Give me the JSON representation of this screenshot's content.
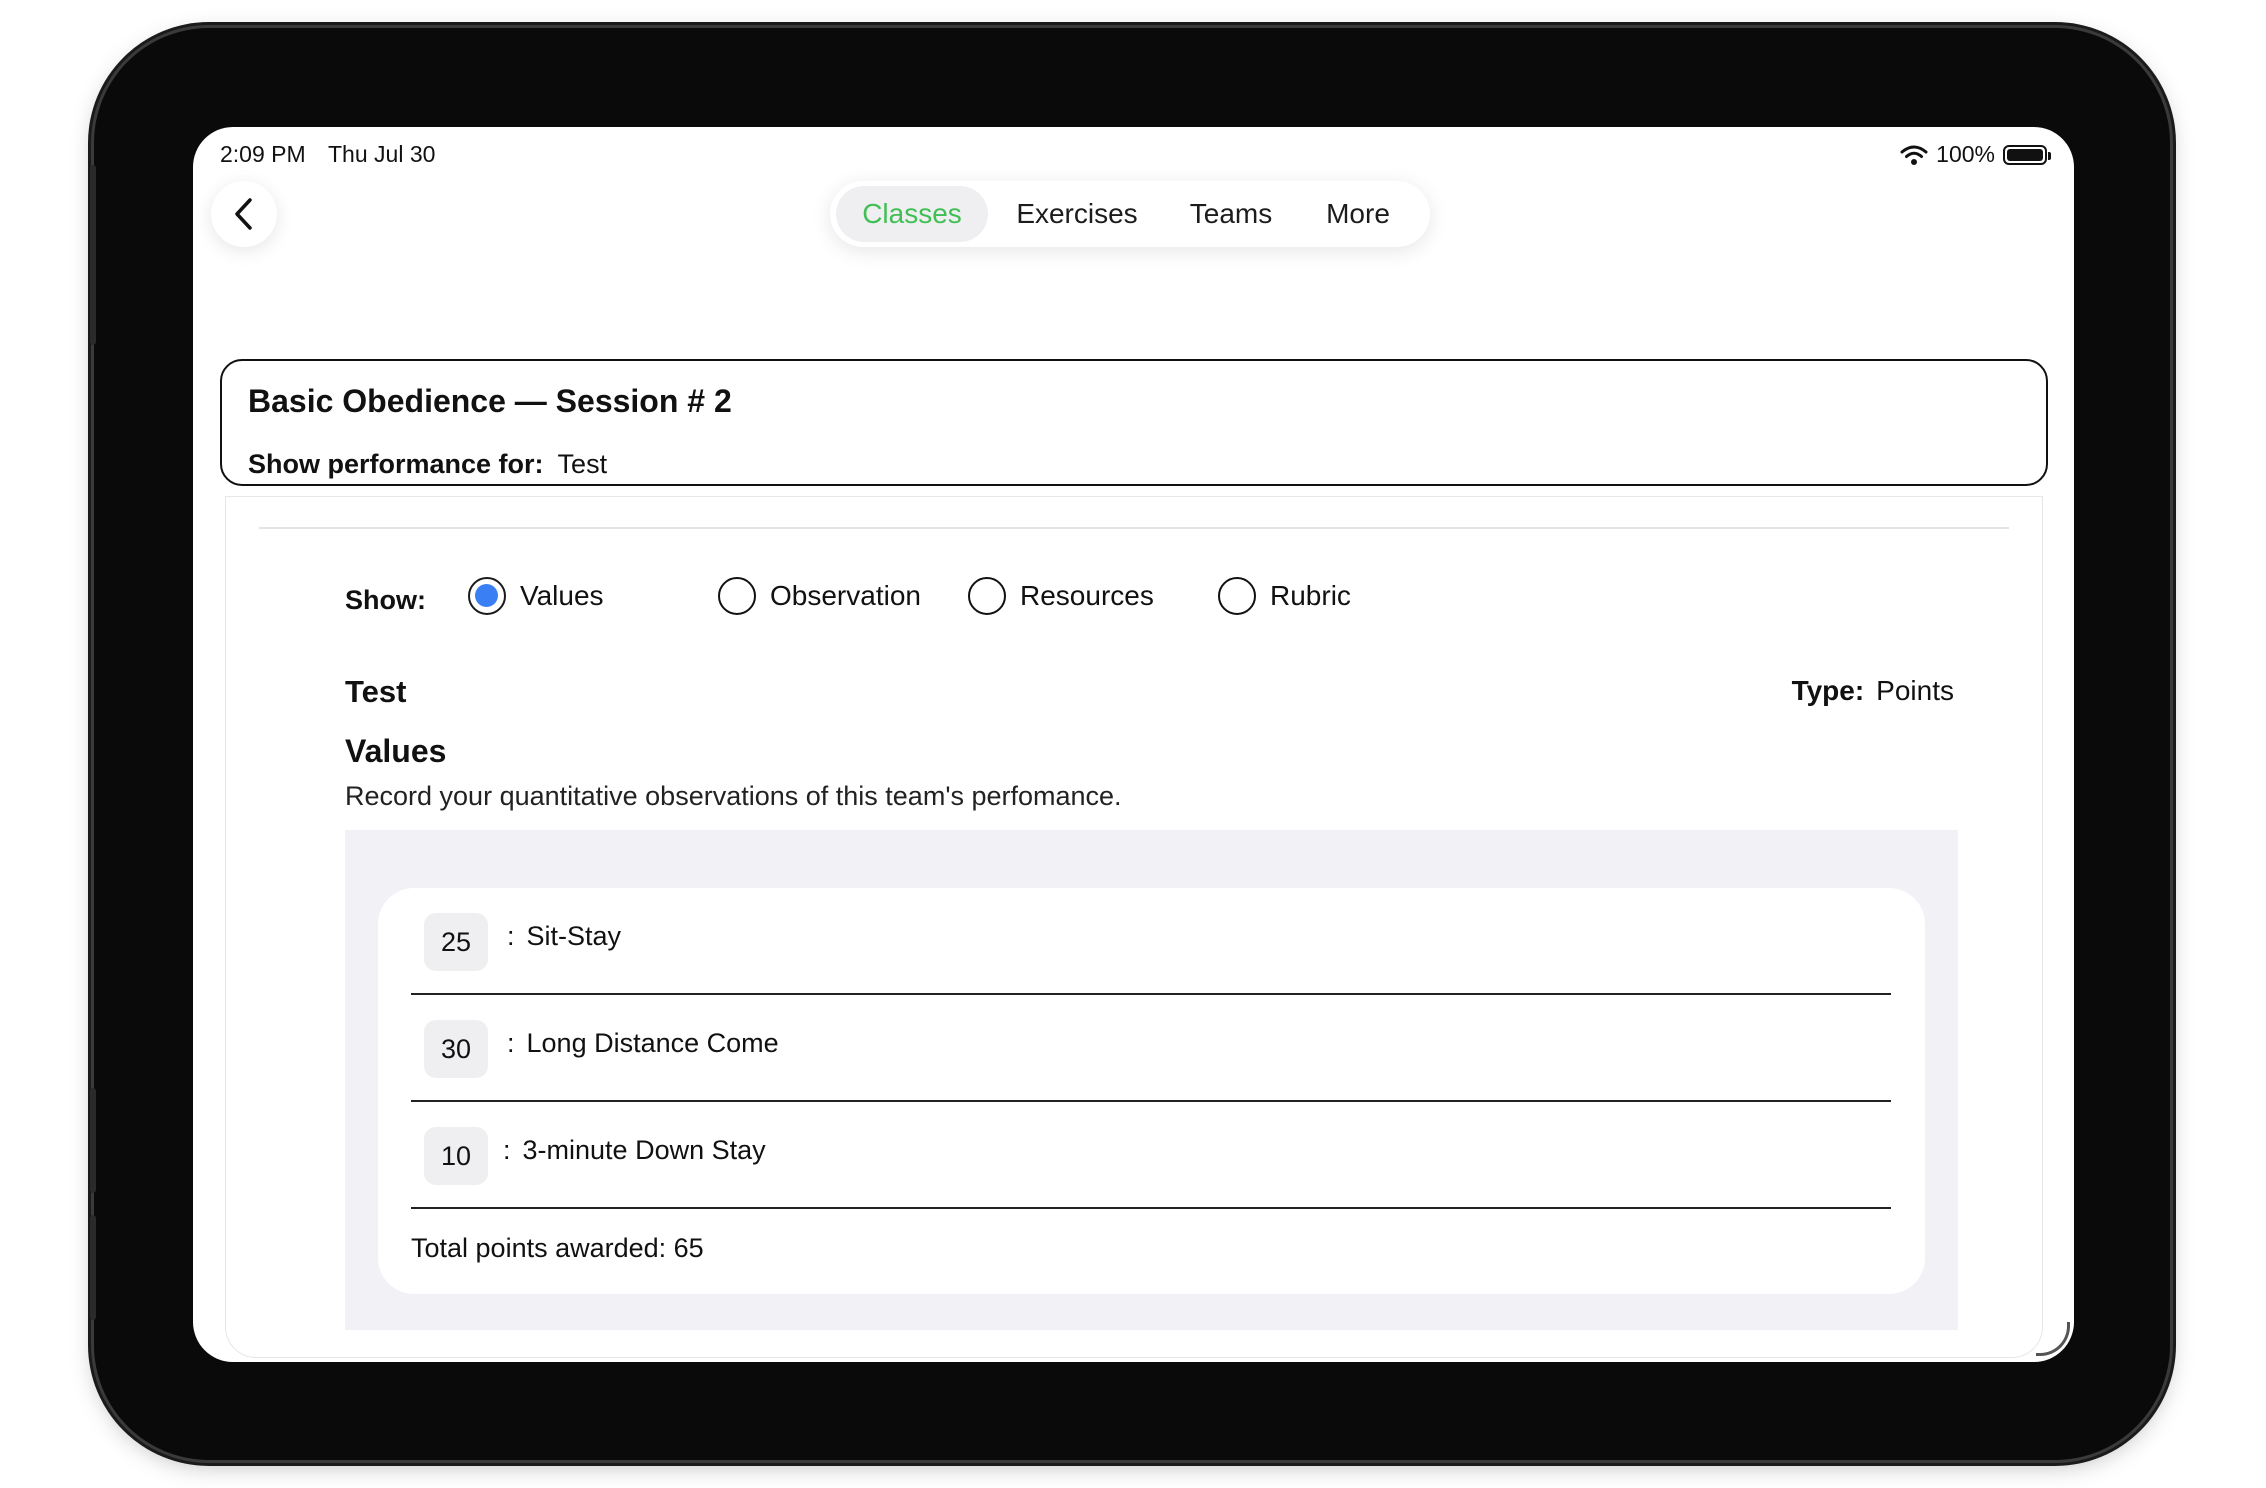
{
  "status_bar": {
    "time": "2:09 PM",
    "date": "Thu Jul 30",
    "battery_text": "100%",
    "wifi_icon": "wifi-icon",
    "battery_icon": "battery-icon"
  },
  "nav": {
    "back_icon": "chevron-left-icon",
    "tabs": [
      {
        "label": "Classes",
        "active": true
      },
      {
        "label": "Exercises",
        "active": false
      },
      {
        "label": "Teams",
        "active": false
      },
      {
        "label": "More",
        "active": false
      }
    ],
    "active_color": "#3fbf54"
  },
  "header": {
    "title": "Basic Obedience — Session # 2",
    "performance_label": "Show performance for:",
    "performance_value": "Test"
  },
  "show": {
    "label": "Show:",
    "options": [
      {
        "label": "Values",
        "checked": true
      },
      {
        "label": "Observation",
        "checked": false
      },
      {
        "label": "Resources",
        "checked": false
      },
      {
        "label": "Rubric",
        "checked": false
      }
    ],
    "checked_color": "#3b7ff5"
  },
  "exercise": {
    "name": "Test",
    "type_label": "Type:",
    "type_value": "Points"
  },
  "values_section": {
    "title": "Values",
    "description": "Record your quantitative observations of this team's perfomance.",
    "items": [
      {
        "value": "25",
        "label": "Sit-Stay"
      },
      {
        "value": "30",
        "label": "Long Distance Come"
      },
      {
        "value": "10",
        "label": "3-minute Down Stay"
      }
    ],
    "total": "Total points awarded: 65"
  }
}
